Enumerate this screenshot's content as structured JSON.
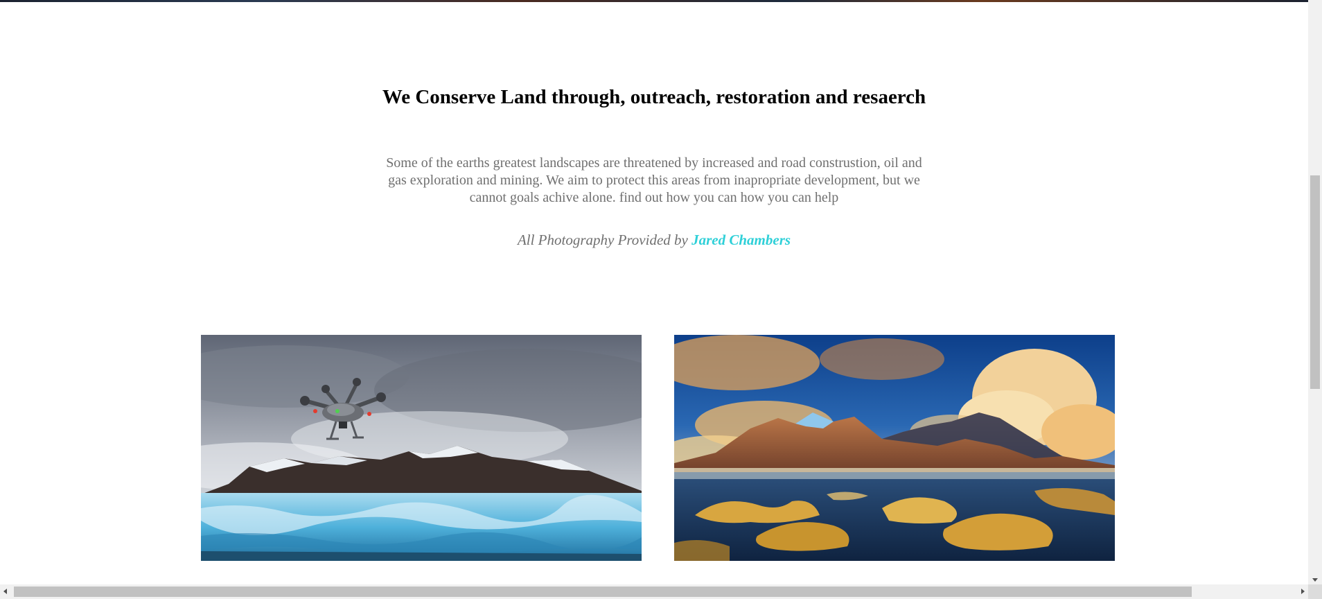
{
  "main": {
    "heading": "We Conserve Land through, outreach, restoration and resaerch",
    "intro": "Some of the earths greatest landscapes are threatened by increased and road construstion, oil and gas exploration and mining. We aim to protect this areas from inapropriate development, but we cannot goals achive alone. find out how you can how you can help",
    "credit_prefix": "All Photography Provided by",
    "credit_name": "Jared Chambers"
  },
  "photos": [
    {
      "icon": "drone-over-glacier-photo"
    },
    {
      "icon": "mountain-sunset-photo"
    }
  ],
  "colors": {
    "heading": "#000000",
    "body_text": "#6f6f6f",
    "link": "#2fd0d8",
    "background": "#ffffff"
  }
}
